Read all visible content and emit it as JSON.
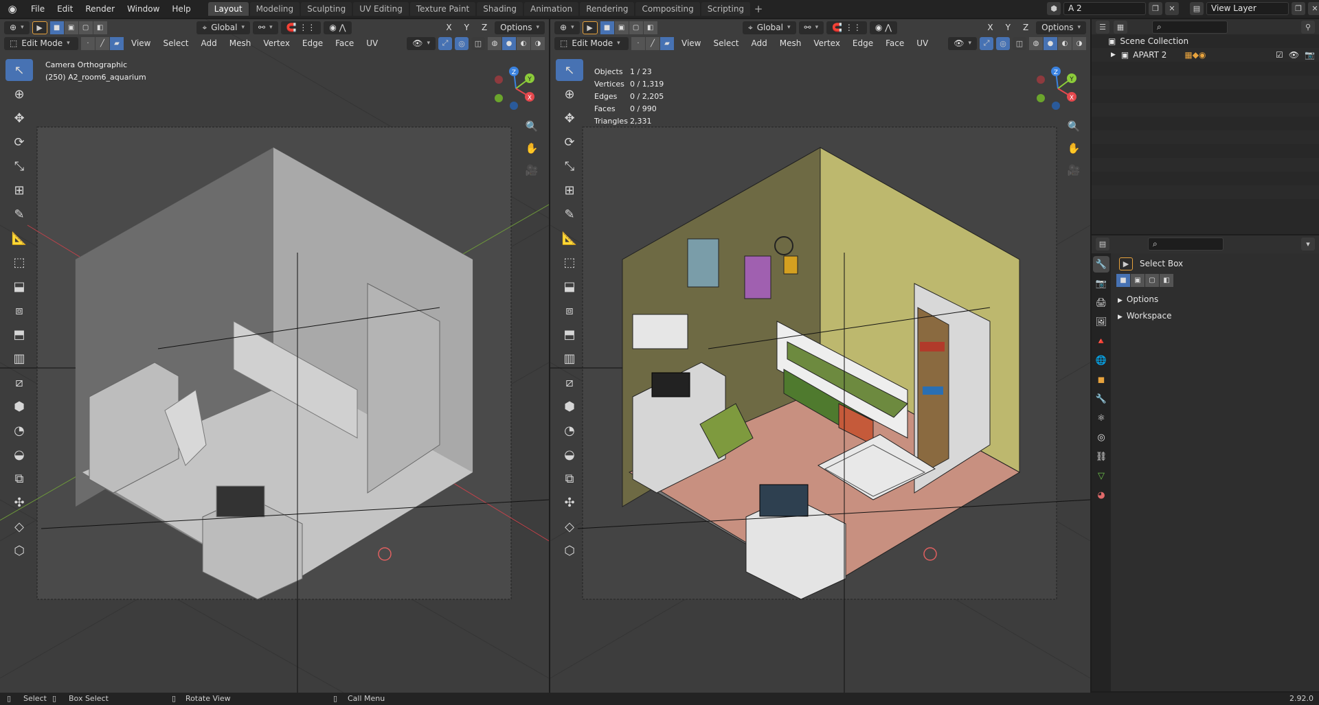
{
  "menu": [
    "File",
    "Edit",
    "Render",
    "Window",
    "Help"
  ],
  "workspaces": [
    "Layout",
    "Modeling",
    "Sculpting",
    "UV Editing",
    "Texture Paint",
    "Shading",
    "Animation",
    "Rendering",
    "Compositing",
    "Scripting"
  ],
  "active_workspace": "Layout",
  "scene_name": "A 2",
  "view_layer": "View Layer",
  "left_viewport": {
    "mode": "Edit Mode",
    "transform_orientation": "Global",
    "options_label": "Options",
    "axes": [
      "X",
      "Y",
      "Z"
    ],
    "menus": [
      "View",
      "Select",
      "Add",
      "Mesh",
      "Vertex",
      "Edge",
      "Face",
      "UV"
    ],
    "camera_label": "Camera Orthographic",
    "object_label": "(250) A2_room6_aquarium"
  },
  "right_viewport": {
    "mode": "Edit Mode",
    "transform_orientation": "Global",
    "options_label": "Options",
    "axes": [
      "X",
      "Y",
      "Z"
    ],
    "menus": [
      "View",
      "Select",
      "Add",
      "Mesh",
      "Vertex",
      "Edge",
      "Face",
      "UV"
    ],
    "stats": [
      {
        "label": "Objects",
        "value": "1 / 23"
      },
      {
        "label": "Vertices",
        "value": "0 / 1,319"
      },
      {
        "label": "Edges",
        "value": "0 / 2,205"
      },
      {
        "label": "Faces",
        "value": "0 / 990"
      },
      {
        "label": "Triangles",
        "value": "2,331"
      }
    ]
  },
  "gizmo": {
    "x": "X",
    "y": "Y",
    "z": "Z"
  },
  "outliner": {
    "items": [
      "Scene Collection",
      "APART 2"
    ]
  },
  "properties": {
    "tool_name": "Select Box",
    "panels": [
      "Options",
      "Workspace"
    ]
  },
  "statusbar": {
    "select": "Select",
    "box_select": "Box Select",
    "rotate_view": "Rotate View",
    "call_menu": "Call Menu",
    "version": "2.92.0"
  },
  "colors": {
    "accent": "#4772b3",
    "axis_x": "#e5484d",
    "axis_y": "#8ccc3a",
    "axis_z": "#3a82e0",
    "floor_right": "#c89080",
    "wall_left_right": "#6e6a44",
    "wall_right_right": "#bdb86e",
    "bed_green": "#6d8a3f"
  }
}
